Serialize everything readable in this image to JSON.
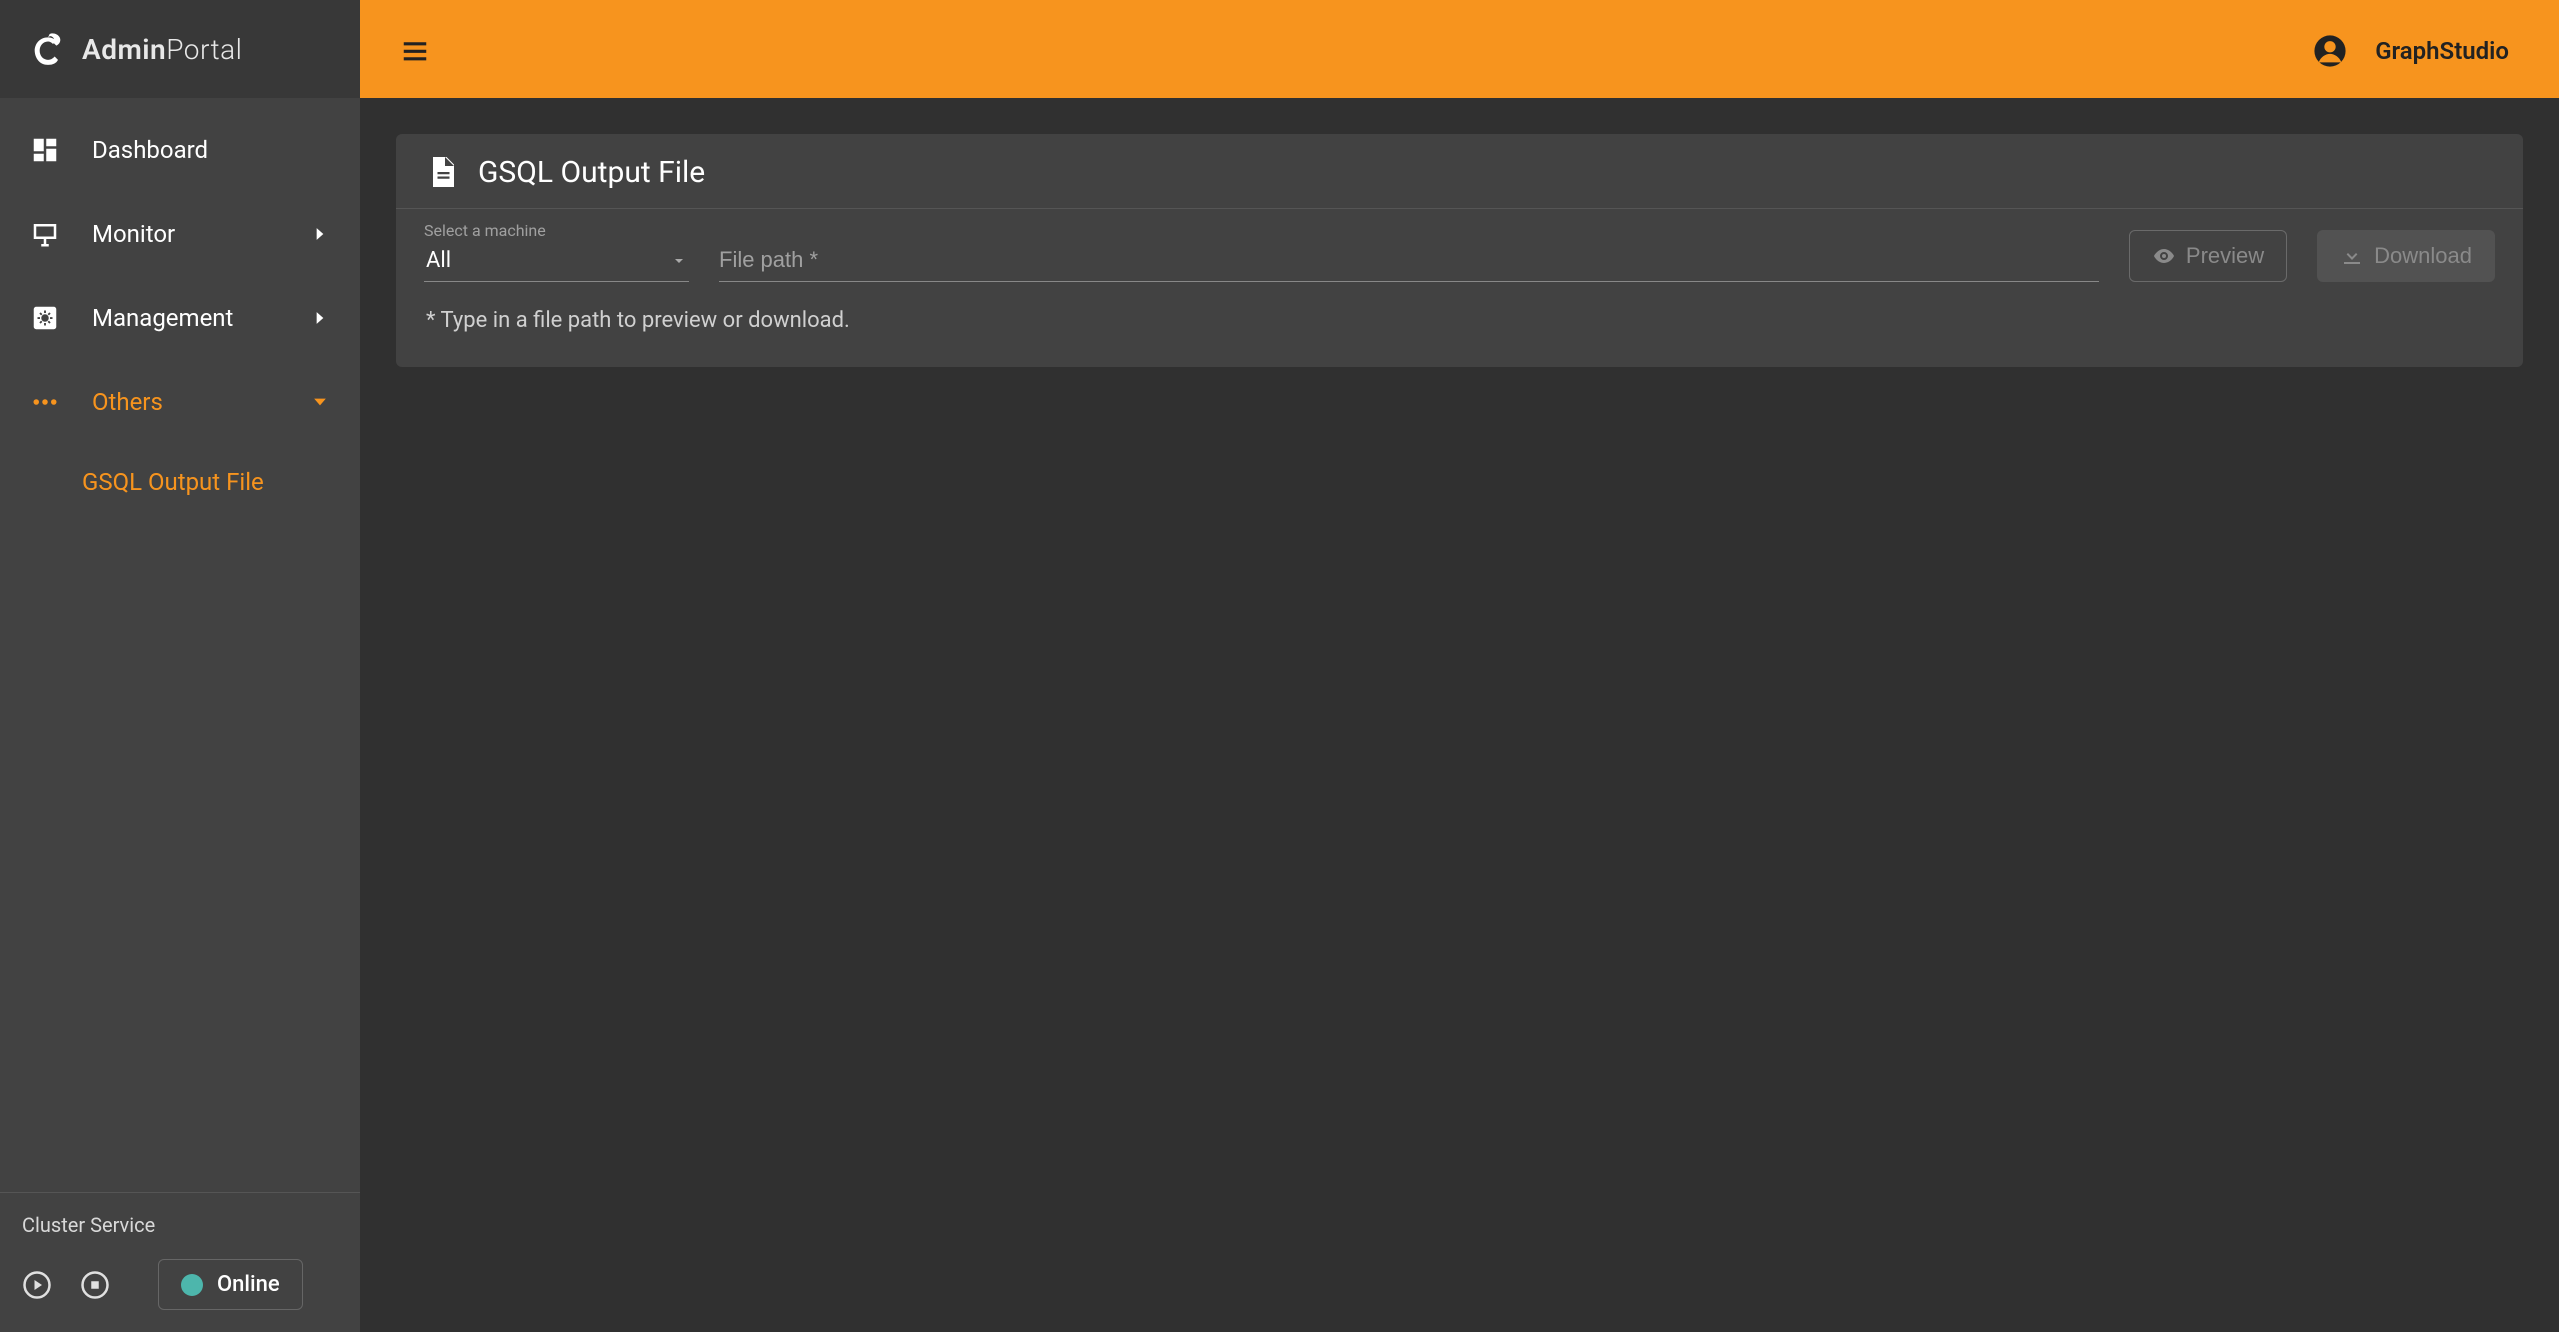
{
  "brand": {
    "bold": "Admin",
    "light": "Portal"
  },
  "sidebar": {
    "items": [
      {
        "label": "Dashboard"
      },
      {
        "label": "Monitor"
      },
      {
        "label": "Management"
      },
      {
        "label": "Others"
      }
    ],
    "sub": {
      "label": "GSQL Output File"
    }
  },
  "footer": {
    "title": "Cluster Service",
    "status": "Online"
  },
  "topbar": {
    "user": "GraphStudio"
  },
  "page": {
    "title": "GSQL Output File",
    "select_label": "Select a machine",
    "select_value": "All",
    "file_placeholder": "File path *",
    "preview_label": "Preview",
    "download_label": "Download",
    "helper": "* Type in a file path to preview or download."
  }
}
